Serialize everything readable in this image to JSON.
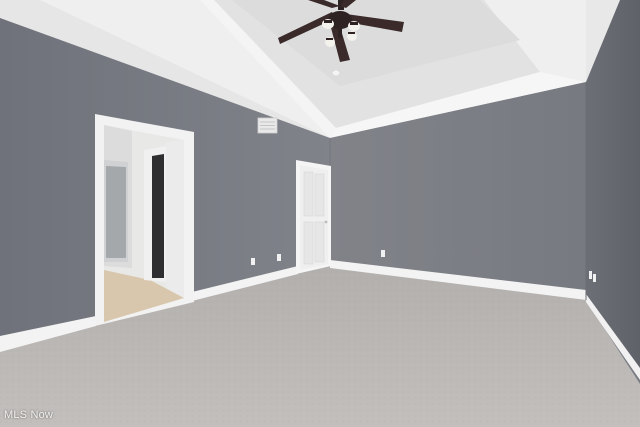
{
  "photo": {
    "subject": "empty-bedroom",
    "watermark": "MLS Now",
    "colors": {
      "wall": "#7b7e86",
      "wall_right": "#6f7279",
      "ceiling": "#ededed",
      "carpet": "#b9b6b3",
      "trim": "#f4f4f4",
      "fan_blade": "#3a2a2a"
    }
  }
}
